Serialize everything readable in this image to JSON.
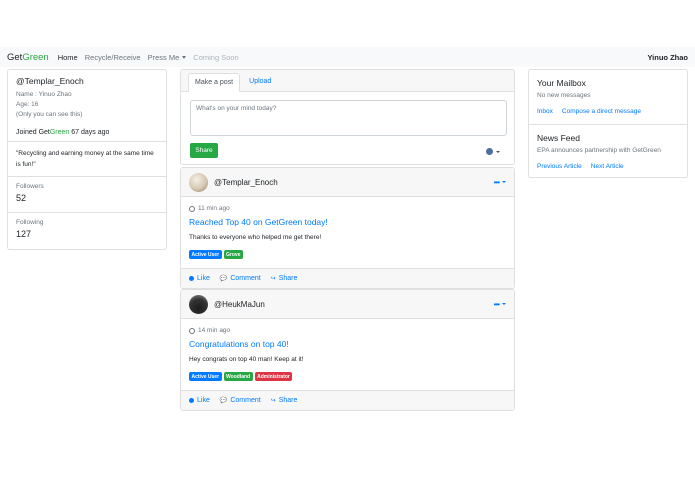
{
  "navbar": {
    "brand_prefix": "Get",
    "brand_suffix": "Green",
    "links": [
      "Home",
      "Recycle/Receive",
      "Press Me",
      "Coming Soon"
    ],
    "user": "Yinuo Zhao"
  },
  "profile": {
    "handle": "@Templar_Enoch",
    "name_line": "Name : Yinuo Zhao",
    "age_line": "Age: 16",
    "privacy_note": "(Only you can see this)",
    "joined_prefix": "Joined Get",
    "joined_brand": "Green",
    "joined_suffix": " 67 days ago",
    "quote": "\"Recycling and earning money at the same time is fun!\"",
    "followers_label": "Followers",
    "followers_count": "52",
    "following_label": "Following",
    "following_count": "127"
  },
  "composer": {
    "tabs": [
      "Make a post",
      "Upload"
    ],
    "placeholder": "What's on your mind today?",
    "share_label": "Share",
    "icons": {
      "privacy": "globe-icon"
    }
  },
  "posts": [
    {
      "user": "@Templar_Enoch",
      "time": "11 min ago",
      "title": "Reached Top 40 on GetGreen today!",
      "text": "Thanks to everyone who helped me get there!",
      "badges": [
        {
          "label": "Active User",
          "color": "#007bff"
        },
        {
          "label": "Grove",
          "color": "#28a745"
        }
      ]
    },
    {
      "user": "@HeukMaJun",
      "time": "14 min ago",
      "title": "Congratulations on top 40!",
      "text": "Hey congrats on top 40 man! Keep at it!",
      "badges": [
        {
          "label": "Active User",
          "color": "#007bff"
        },
        {
          "label": "Woodland",
          "color": "#28a745"
        },
        {
          "label": "Administrator",
          "color": "#dc3545"
        }
      ]
    }
  ],
  "post_actions": [
    "Like",
    "Comment",
    "Share"
  ],
  "mailbox": {
    "title": "Your Mailbox",
    "status": "No new messages",
    "links": [
      "Inbox",
      "Compose a direct message"
    ]
  },
  "newsfeed": {
    "title": "News Feed",
    "item": "EPA announces partnership with GetGreen",
    "links": [
      "Previous Article",
      "Next Article"
    ]
  },
  "colors": {
    "brand_green": "#28a745",
    "link_blue": "#007bff"
  }
}
